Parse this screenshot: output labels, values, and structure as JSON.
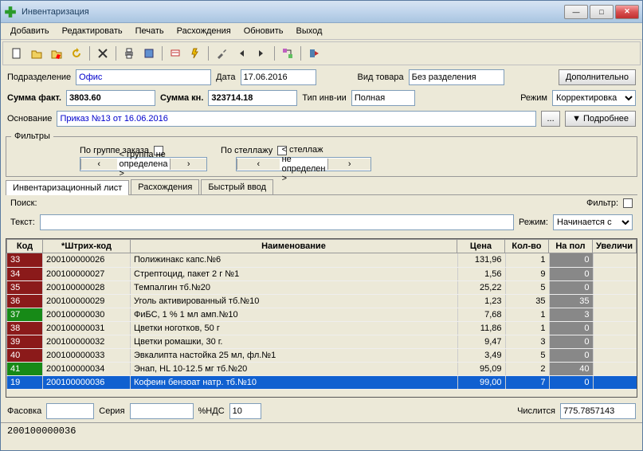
{
  "window": {
    "title": "Инвентаризация"
  },
  "menu": [
    "Добавить",
    "Редактировать",
    "Печать",
    "Расхождения",
    "Обновить",
    "Выход"
  ],
  "form": {
    "dept_label": "Подразделение",
    "dept": "Офис",
    "date_label": "Дата",
    "date": "17.06.2016",
    "goods_label": "Вид товара",
    "goods": "Без разделения",
    "extra_btn": "Дополнительно",
    "sumfact_label": "Сумма факт.",
    "sumfact": "3803.60",
    "sumkn_label": "Сумма кн.",
    "sumkn": "323714.18",
    "invtype_label": "Тип инв-ии",
    "invtype": "Полная",
    "mode_label": "Режим",
    "mode": "Корректировка",
    "basis_label": "Основание",
    "basis": "Приказ №13 от 16.06.2016",
    "basis_btn": "...",
    "more_btn": "Подробнее"
  },
  "filters": {
    "legend": "Фильтры",
    "bygroup": "По группе заказа",
    "grpspin": "< группа не определена >",
    "byshelf": "По стеллажу",
    "shelfspin": "< стеллаж не определен >"
  },
  "tabs": [
    "Инвентаризационный лист",
    "Расхождения",
    "Быстрый ввод"
  ],
  "search": {
    "legend": "Поиск:",
    "text_label": "Текст:",
    "text": "",
    "mode_label": "Режим:",
    "mode": "Начинается с",
    "filter_label": "Фильтр:"
  },
  "cols": [
    "Код",
    "*Штрих-код",
    "Наименование",
    "Цена",
    "Кол-во",
    "На пол",
    "Увеличи"
  ],
  "rows": [
    {
      "code": "33",
      "codecolor": "#8b1a1a",
      "bar": "200100000026",
      "name": "Полижинакс капс.№6",
      "price": "131,96",
      "qty": "1",
      "shelf": "0"
    },
    {
      "code": "34",
      "codecolor": "#8b1a1a",
      "bar": "200100000027",
      "name": "Стрептоцид, пакет 2 г №1",
      "price": "1,56",
      "qty": "9",
      "shelf": "0"
    },
    {
      "code": "35",
      "codecolor": "#8b1a1a",
      "bar": "200100000028",
      "name": "Темпалгин тб.№20",
      "price": "25,22",
      "qty": "5",
      "shelf": "0"
    },
    {
      "code": "36",
      "codecolor": "#8b1a1a",
      "bar": "200100000029",
      "name": "Уголь активированный тб.№10",
      "price": "1,23",
      "qty": "35",
      "shelf": "35"
    },
    {
      "code": "37",
      "codecolor": "#178a17",
      "bar": "200100000030",
      "name": "ФиБС, 1 % 1 мл амп.№10",
      "price": "7,68",
      "qty": "1",
      "shelf": "3"
    },
    {
      "code": "38",
      "codecolor": "#8b1a1a",
      "bar": "200100000031",
      "name": "Цветки ноготков, 50 г",
      "price": "11,86",
      "qty": "1",
      "shelf": "0"
    },
    {
      "code": "39",
      "codecolor": "#8b1a1a",
      "bar": "200100000032",
      "name": "Цветки ромашки, 30 г.",
      "price": "9,47",
      "qty": "3",
      "shelf": "0"
    },
    {
      "code": "40",
      "codecolor": "#8b1a1a",
      "bar": "200100000033",
      "name": "Эвкалипта настойка 25 мл, фл.№1",
      "price": "3,49",
      "qty": "5",
      "shelf": "0"
    },
    {
      "code": "41",
      "codecolor": "#178a17",
      "bar": "200100000034",
      "name": "Энап, HL 10-12.5 мг тб.№20",
      "price": "95,09",
      "qty": "2",
      "shelf": "40"
    },
    {
      "code": "19",
      "codecolor": "#1060d0",
      "bar": "200100000036",
      "name": "Кофеин бензоат натр. тб.№10",
      "price": "99,00",
      "qty": "7",
      "shelf": "0",
      "sel": true
    }
  ],
  "footer": {
    "pack_label": "Фасовка",
    "pack": "",
    "series_label": "Серия",
    "series": "",
    "vat_label": "%НДС",
    "vat": "10",
    "count_label": "Числится",
    "count": "775.7857143"
  },
  "status": "200100000036"
}
